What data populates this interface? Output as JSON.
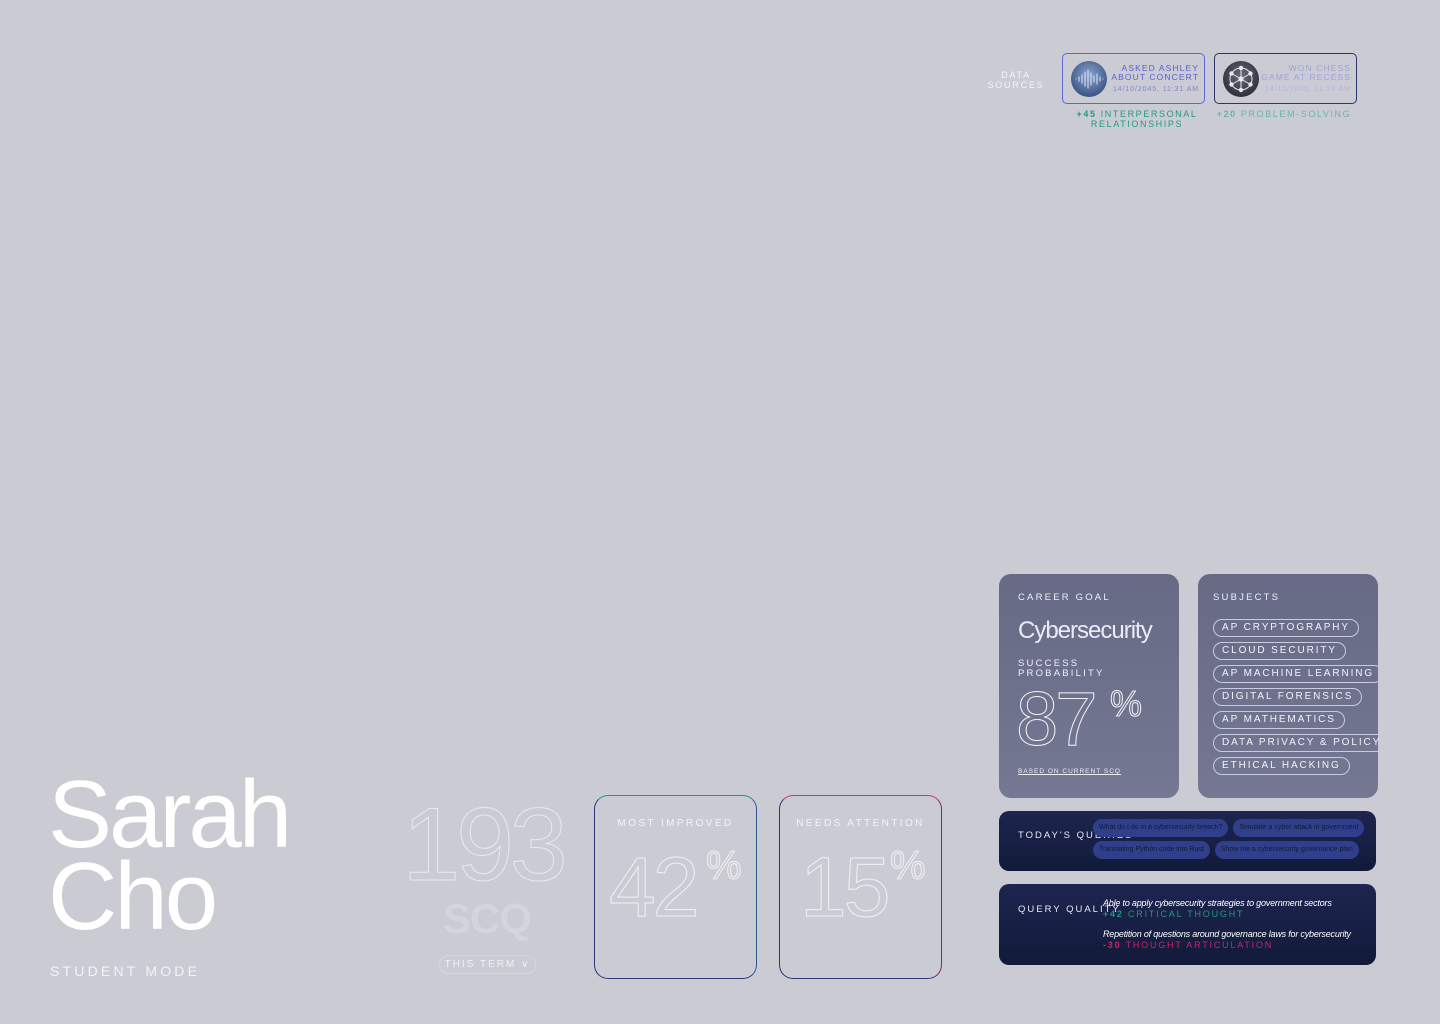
{
  "data_sources": {
    "label": "DATA SOURCES",
    "items": [
      {
        "title": "ASKED ASHLEY ABOUT CONCERT",
        "timestamp": "14/10/2045, 11:31 AM",
        "delta": "+45",
        "skill": "INTERPERSONAL RELATIONSHIPS",
        "icon": "audio-waveform-icon"
      },
      {
        "title": "WON CHESS GAME AT RECESS",
        "timestamp": "14/10/2045, 11:24 AM",
        "delta": "+20",
        "skill": "PROBLEM-SOLVING",
        "icon": "network-nodes-icon"
      }
    ]
  },
  "student": {
    "first_name": "Sarah",
    "last_name": "Cho",
    "mode": "STUDENT MODE"
  },
  "scq": {
    "value": "193",
    "unit": "SCQ",
    "period_label": "THIS TERM ∨"
  },
  "stats": {
    "most_improved": {
      "title": "MOST IMPROVED",
      "value": "42",
      "unit": "%"
    },
    "needs_attention": {
      "title": "NEEDS ATTENTION",
      "value": "15",
      "unit": "%"
    }
  },
  "career": {
    "label": "CAREER GOAL",
    "goal": "Cybersecurity",
    "success_label": "SUCCESS PROBABILITY",
    "success_value": "87",
    "success_unit": "%",
    "footnote": "BASED ON CURRENT SCQ"
  },
  "subjects": {
    "label": "SUBJECTS",
    "items": [
      "AP CRYPTOGRAPHY",
      "CLOUD SECURITY",
      "AP MACHINE LEARNING",
      "DIGITAL FORENSICS",
      "AP MATHEMATICS",
      "DATA PRIVACY & POLICY",
      "ETHICAL HACKING"
    ]
  },
  "queries": {
    "label": "TODAY'S QUERIES",
    "items": [
      "What do I do in a cybersecurity breach?",
      "Simulate a cyber attack in government",
      "Translating Python code into Rust",
      "Show me a cybersecurity governance plan"
    ]
  },
  "query_quality": {
    "label": "QUERY QUALITY",
    "items": [
      {
        "note": "Able to apply cybersecurity strategies to government sectors",
        "delta": "+42",
        "skill": "CRITICAL THOUGHT",
        "sign": "pos"
      },
      {
        "note": "Repetition of questions around governance laws for cybersecurity",
        "delta": "-30",
        "skill": "THOUGHT ARTICULATION",
        "sign": "neg"
      }
    ]
  },
  "colors": {
    "background": "#cbcbd4",
    "positive": "#1a9e7c",
    "negative": "#d6326a",
    "accent_blue": "#5b66d9",
    "panel_dark": "#1d2550"
  }
}
